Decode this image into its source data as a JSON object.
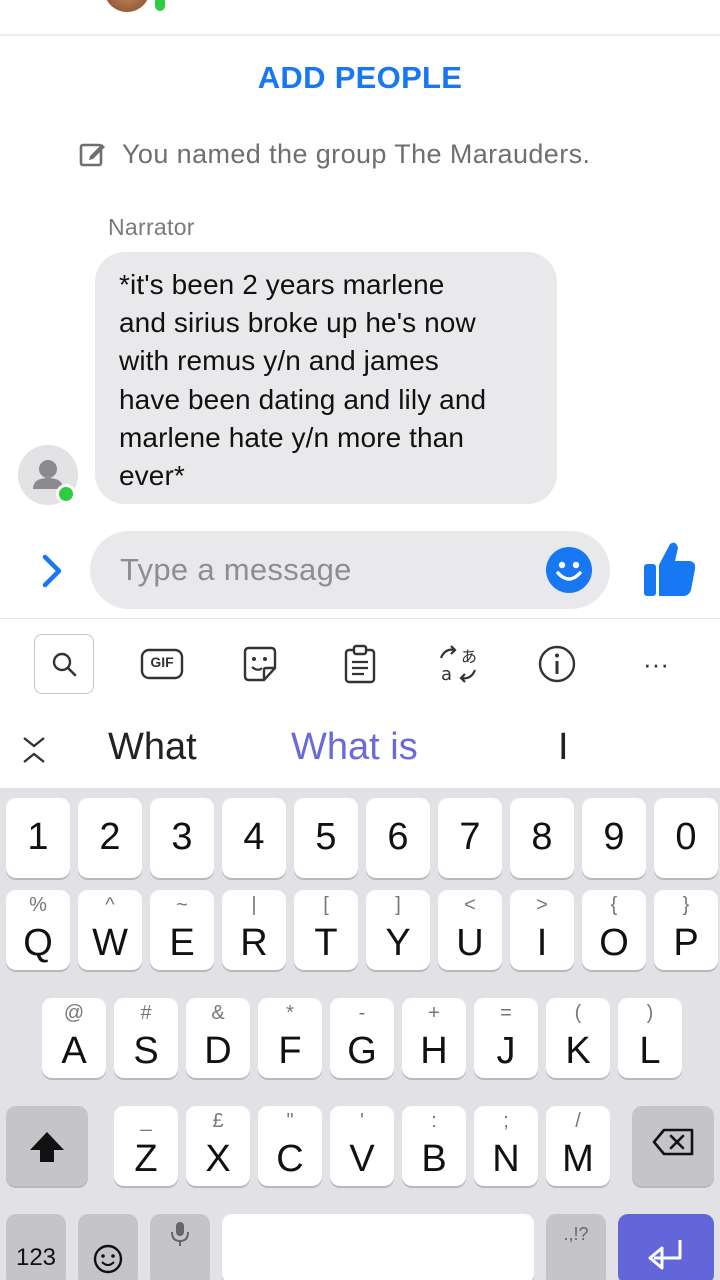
{
  "chat": {
    "add_people": "ADD PEOPLE",
    "system_message": "You named the group The Marauders.",
    "sender": "Narrator",
    "message_lines": [
      "*it's been 2 years marlene",
      "and sirius broke up he's now",
      "with remus y/n and james",
      "have been dating and lily and",
      "marlene hate y/n more than",
      "ever*"
    ]
  },
  "composer": {
    "placeholder": "Type a message"
  },
  "keyboard_toolbar": {
    "gif_label": "GIF",
    "more_label": "···"
  },
  "suggestions": [
    "What",
    "What is",
    "I"
  ],
  "keyboard": {
    "number_row": [
      "1",
      "2",
      "3",
      "4",
      "5",
      "6",
      "7",
      "8",
      "9",
      "0"
    ],
    "row1": [
      {
        "main": "Q",
        "sub": "%"
      },
      {
        "main": "W",
        "sub": "^"
      },
      {
        "main": "E",
        "sub": "~"
      },
      {
        "main": "R",
        "sub": "|"
      },
      {
        "main": "T",
        "sub": "["
      },
      {
        "main": "Y",
        "sub": "]"
      },
      {
        "main": "U",
        "sub": "<"
      },
      {
        "main": "I",
        "sub": ">"
      },
      {
        "main": "O",
        "sub": "{"
      },
      {
        "main": "P",
        "sub": "}"
      }
    ],
    "row2": [
      {
        "main": "A",
        "sub": "@"
      },
      {
        "main": "S",
        "sub": "#"
      },
      {
        "main": "D",
        "sub": "&"
      },
      {
        "main": "F",
        "sub": "*"
      },
      {
        "main": "G",
        "sub": "-"
      },
      {
        "main": "H",
        "sub": "+"
      },
      {
        "main": "J",
        "sub": "="
      },
      {
        "main": "K",
        "sub": "("
      },
      {
        "main": "L",
        "sub": ")"
      }
    ],
    "row3": [
      {
        "main": "Z",
        "sub": "_"
      },
      {
        "main": "X",
        "sub": "£"
      },
      {
        "main": "C",
        "sub": "\""
      },
      {
        "main": "V",
        "sub": "'"
      },
      {
        "main": "B",
        "sub": ":"
      },
      {
        "main": "N",
        "sub": ";"
      },
      {
        "main": "M",
        "sub": "/"
      }
    ],
    "numbers_label": "123",
    "punct_label": ".,!?"
  },
  "colors": {
    "accent_blue": "#1877f2",
    "online_green": "#2ecc40",
    "suggestion_purple": "#6a6bd8",
    "enter_key": "#6266d9"
  }
}
